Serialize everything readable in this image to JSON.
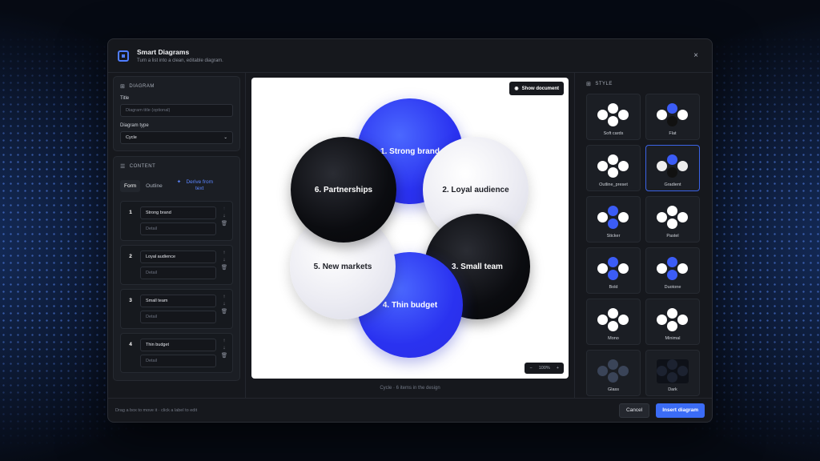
{
  "header": {
    "title": "Smart Diagrams",
    "subtitle": "Turn a list into a clean, editable diagram.",
    "close": "×"
  },
  "diagram_section": {
    "heading": "DIAGRAM",
    "title_label": "Title",
    "title_placeholder": "Diagram title (optional)",
    "type_label": "Diagram type",
    "type_value": "Cycle"
  },
  "content_section": {
    "heading": "CONTENT",
    "tabs": [
      "Form",
      "Outline"
    ],
    "derive_label": "Derive from text",
    "items": [
      {
        "num": "1",
        "label": "Strong brand",
        "detail_placeholder": "Detail"
      },
      {
        "num": "2",
        "label": "Loyal audience",
        "detail_placeholder": "Detail"
      },
      {
        "num": "3",
        "label": "Small team",
        "detail_placeholder": "Detail"
      },
      {
        "num": "4",
        "label": "Thin budget",
        "detail_placeholder": "Detail"
      }
    ]
  },
  "canvas": {
    "show_document": "Show document",
    "circles": [
      {
        "label": "1. Strong brand",
        "fill": "blue"
      },
      {
        "label": "2. Loyal audience",
        "fill": "light"
      },
      {
        "label": "3. Small team",
        "fill": "black"
      },
      {
        "label": "4. Thin budget",
        "fill": "blue"
      },
      {
        "label": "5. New markets",
        "fill": "light"
      },
      {
        "label": "6. Partnerships",
        "fill": "black"
      }
    ],
    "zoom": {
      "minus": "−",
      "value": "100%",
      "plus": "+"
    },
    "caption": "Cycle · 6 items in the design"
  },
  "style_section": {
    "heading": "STYLE",
    "selected": "Gradient",
    "styles": [
      "Soft cards",
      "Flat",
      "Outline_preset",
      "Gradient",
      "Sticker",
      "Pastel",
      "Bold",
      "Duotone",
      "Mono",
      "Minimal",
      "Glass",
      "Dark"
    ]
  },
  "footer": {
    "hint": "Drag a box to move it · click a label to edit",
    "cancel": "Cancel",
    "insert": "Insert diagram"
  },
  "colors": {
    "accent": "#3b6cf6",
    "diagram_blue": "#2a32f0",
    "diagram_black": "#0b0c10",
    "diagram_light": "#ececf3"
  },
  "icons": [
    "app-logo-icon",
    "close-icon",
    "diagram-icon",
    "content-list-icon",
    "sparkle-icon",
    "arrow-up-icon",
    "arrow-down-icon",
    "trash-icon",
    "eye-icon",
    "style-grid-icon",
    "chevron-down-icon"
  ]
}
